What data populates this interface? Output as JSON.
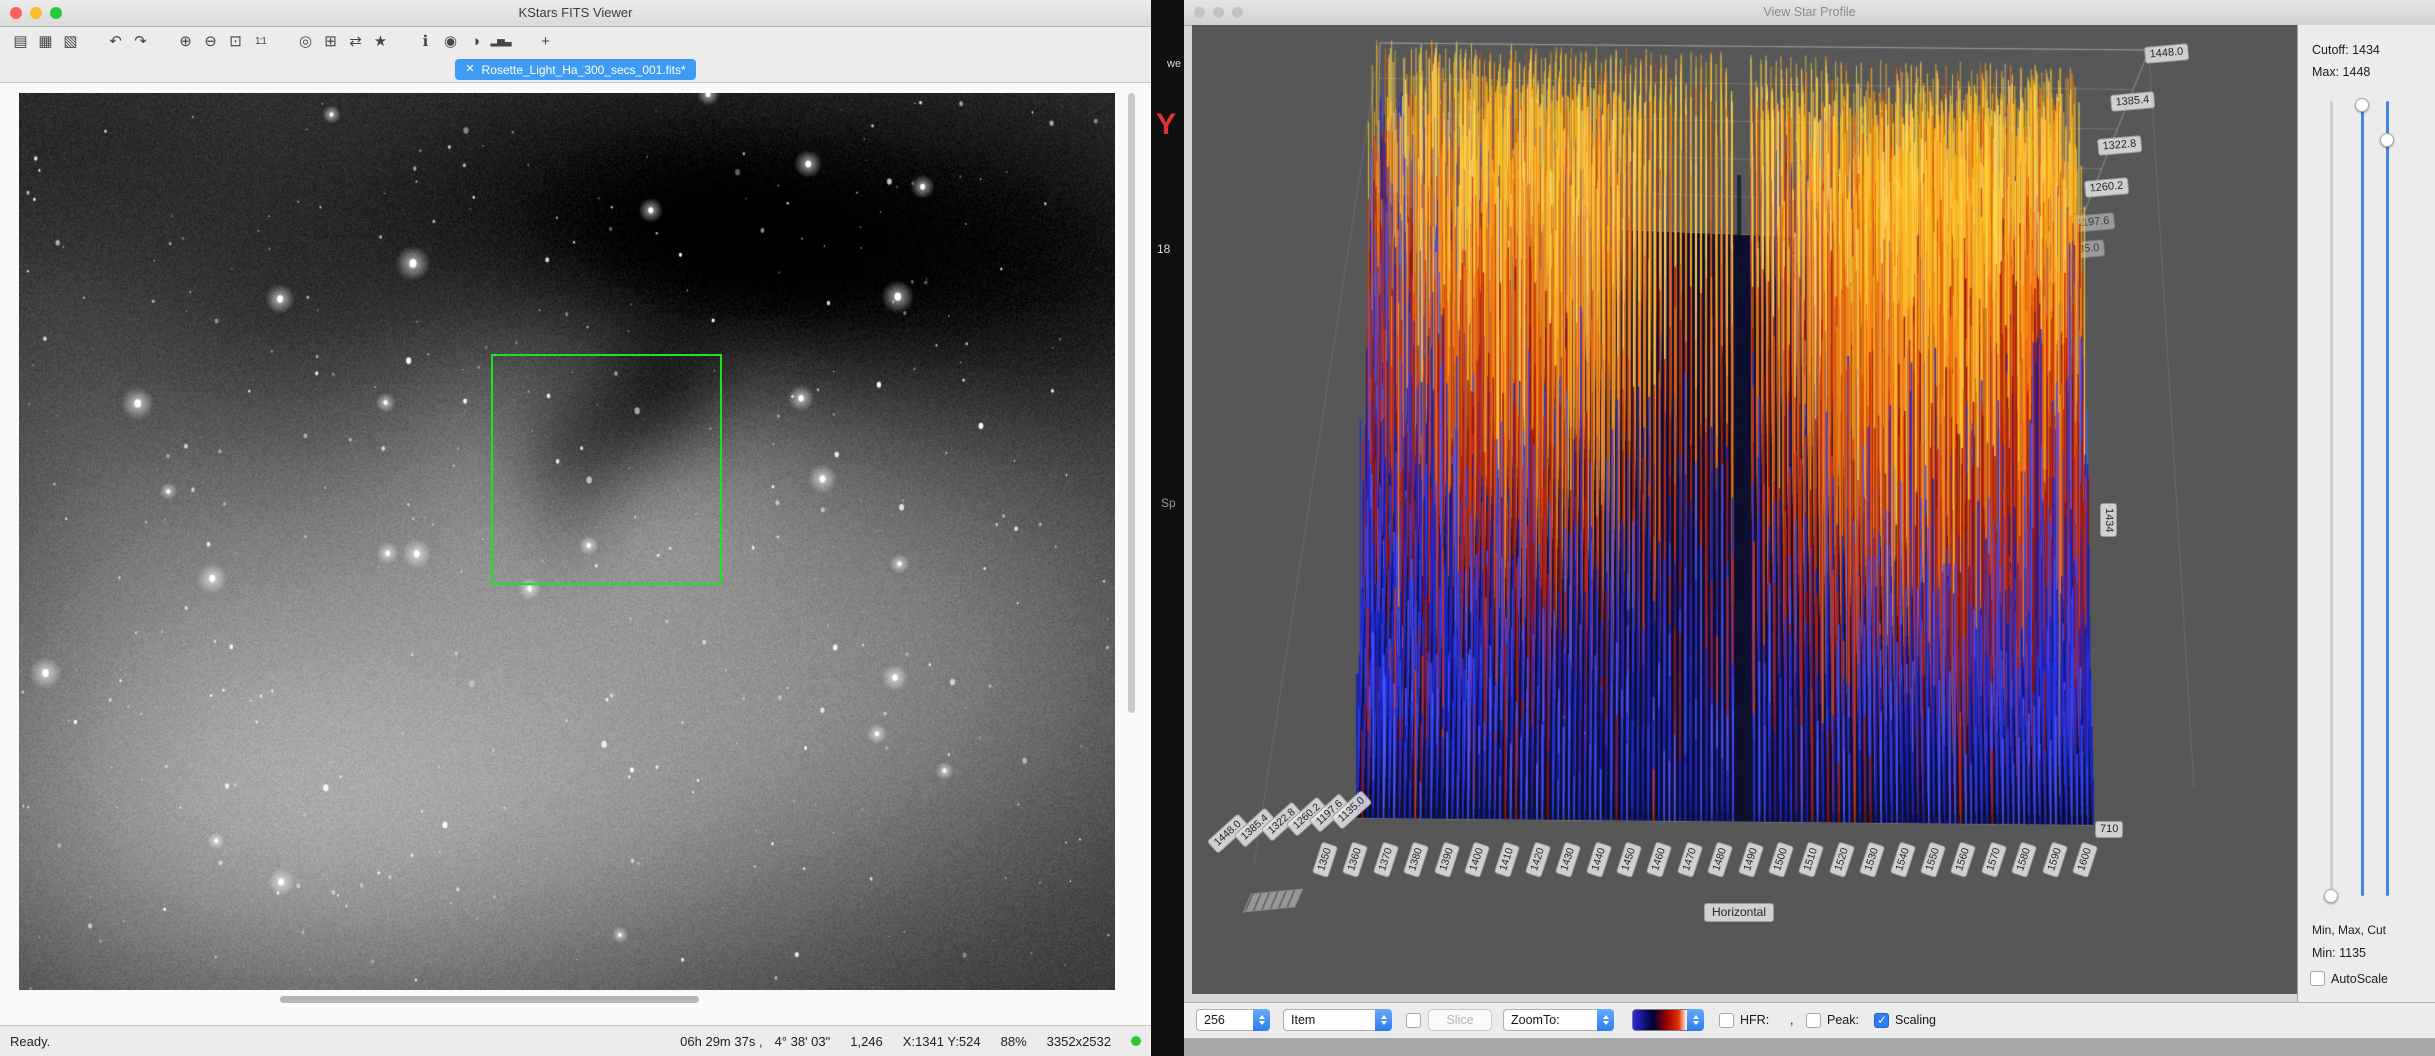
{
  "colors": {
    "selection_green": "#1ee21e",
    "tab_blue": "#3e9bf4",
    "accent_blue": "#2f7cf6",
    "slider_blue": "#4186e0",
    "status_dot_green": "#33c13a",
    "traffic_lights": [
      "#ff5f57",
      "#febc2e",
      "#28c840"
    ],
    "colormap": [
      "#2430e0",
      "#c21f08",
      "#ef7012",
      "#ffc82e"
    ]
  },
  "left_window": {
    "title": "KStars FITS Viewer",
    "toolbar": {
      "groups": [
        [
          {
            "name": "open-file-icon",
            "glyph": "▤"
          },
          {
            "name": "save-file-icon",
            "glyph": "▦"
          },
          {
            "name": "save-as-icon",
            "glyph": "▧"
          }
        ],
        [
          {
            "name": "undo-icon",
            "glyph": "↶"
          },
          {
            "name": "redo-icon",
            "glyph": "↷"
          }
        ],
        [
          {
            "name": "zoom-in-icon",
            "glyph": "⊕"
          },
          {
            "name": "zoom-out-icon",
            "glyph": "⊖"
          },
          {
            "name": "zoom-fit-icon",
            "glyph": "⊡"
          },
          {
            "name": "zoom-actual-icon",
            "glyph": "1:1"
          }
        ],
        [
          {
            "name": "center-telescope-icon",
            "glyph": "◎"
          },
          {
            "name": "grid-overlay-icon",
            "glyph": "⊞"
          },
          {
            "name": "flip-icon",
            "glyph": "⇄"
          },
          {
            "name": "mark-stars-icon",
            "glyph": "★"
          }
        ],
        [
          {
            "name": "info-icon",
            "glyph": "ℹ"
          },
          {
            "name": "crosshair-icon",
            "glyph": "◉"
          },
          {
            "name": "contrast-stretch-icon",
            "glyph": "◑"
          },
          {
            "name": "histogram-icon",
            "glyph": "▂▅▃"
          }
        ],
        [
          {
            "name": "pan-icon",
            "glyph": "+"
          }
        ]
      ]
    },
    "tab": {
      "close_glyph": "✕",
      "label": "Rosette_Light_Ha_300_secs_001.fits*"
    },
    "statusbar": {
      "ready": "Ready.",
      "ra": "06h 29m 37s ,",
      "dec": "4° 38' 03\"",
      "pixel_value": "1,246",
      "cursor": "X:1341 Y:524",
      "zoom": "88%",
      "resolution": "3352x2532"
    }
  },
  "desktop_fragments": {
    "f1": "we",
    "f2": "Y",
    "f3": "18",
    "f4": "Sp"
  },
  "right_window": {
    "title": "View Star Profile",
    "chart": {
      "value_ticks": [
        "1448.0",
        "1385.4",
        "1322.8",
        "1260.2",
        "1197.6",
        "1135.0"
      ],
      "horizontal_ticks": [
        "1350",
        "1360",
        "1370",
        "1380",
        "1390",
        "1400",
        "1410",
        "1420",
        "1430",
        "1440",
        "1450",
        "1460",
        "1470",
        "1480",
        "1490",
        "1500",
        "1510",
        "1520",
        "1530",
        "1540",
        "1550",
        "1560",
        "1570",
        "1580",
        "1590",
        "1600"
      ],
      "horizontal_title": "Horizontal",
      "depth_label": "710",
      "cutoff_label": "1434"
    },
    "side_panel": {
      "cutoff": "Cutoff: 1434",
      "max": "Max: 1448",
      "min_max_cut": "Min, Max, Cut",
      "min": "Min: 1135",
      "autoscale": "AutoScale"
    },
    "toolbar": {
      "sample_size": "256",
      "item": "Item",
      "slice": "Slice",
      "zoom_to": "ZoomTo:",
      "hfr": "HFR:",
      "separator": ",",
      "peak": "Peak:",
      "scaling": "Scaling"
    }
  },
  "chart_data": {
    "type": "bar",
    "subtype": "3d-pixel-value-bars",
    "title": "View Star Profile",
    "value_axis": {
      "min": 1135,
      "max": 1448,
      "ticks": [
        1448.0,
        1385.4,
        1322.8,
        1260.2,
        1197.6,
        1135.0
      ]
    },
    "horizontal_axis": {
      "title": "Horizontal",
      "min": 1350,
      "max": 1600,
      "step": 10
    },
    "depth_axis": {
      "first_visible_tick": 710
    },
    "sample_size": 256,
    "cutoff": 1434,
    "notes": "Dense 3D bar field of FITS pixel values: low values blue, mid red, high orange/yellow; two bright mounds left-center and right-center, tall mixed blue/red spikes toward the back, dark vertical seam at center."
  }
}
